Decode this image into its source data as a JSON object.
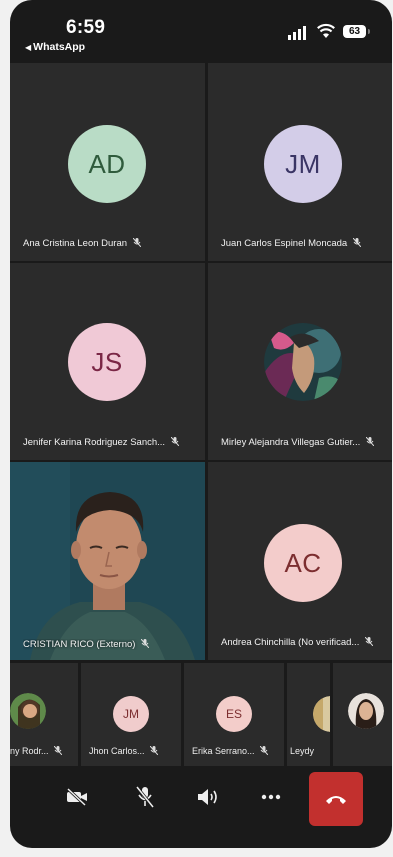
{
  "status_bar": {
    "time": "6:59",
    "back_label": "WhatsApp",
    "battery": "63"
  },
  "tiles": [
    {
      "name": "Ana Cristina Leon Duran",
      "initials": "AD",
      "avatar_bg": "#b9dcc6",
      "avatar_fg": "#2f5b3c"
    },
    {
      "name": "Juan Carlos Espinel Moncada",
      "initials": "JM",
      "avatar_bg": "#d3cde8",
      "avatar_fg": "#3a3565"
    },
    {
      "name": "Jenifer Karina Rodriguez Sanch...",
      "initials": "JS",
      "avatar_bg": "#f0c9d6",
      "avatar_fg": "#7a2746"
    },
    {
      "name": "Mirley Alejandra Villegas Gutier...",
      "initials": "",
      "avatar_bg": "#1f3a3e",
      "avatar_fg": "#ffffff"
    },
    {
      "name": "CRISTIAN RICO (Externo)",
      "initials": "",
      "avatar_bg": "",
      "avatar_fg": ""
    },
    {
      "name": "Andrea Chinchilla  (No verificad...",
      "initials": "AC",
      "avatar_bg": "#f3cccb",
      "avatar_fg": "#7c2e30"
    }
  ],
  "strip": [
    {
      "name": "ny Rodr...",
      "initials": "",
      "avatar_bg": "#d7b38a",
      "avatar_fg": "#333333"
    },
    {
      "name": "Jhon Carlos...",
      "initials": "JM",
      "avatar_bg": "#f0cccc",
      "avatar_fg": "#7c2e30"
    },
    {
      "name": "Erika Serrano...",
      "initials": "ES",
      "avatar_bg": "#f3cdca",
      "avatar_fg": "#7c2e30"
    },
    {
      "name": "Leydy",
      "initials": "",
      "avatar_bg": "#d9c9a0",
      "avatar_fg": "#333333"
    },
    {
      "name": "",
      "initials": "",
      "avatar_bg": "#e8e2dc",
      "avatar_fg": "#333333"
    }
  ],
  "controls": {
    "camera_icon": "camera-off-icon",
    "mic_icon": "mic-off-icon",
    "speaker_icon": "speaker-icon",
    "more_icon": "more-icon",
    "end_call_icon": "end-call-icon",
    "end_call_color": "#c2302e"
  }
}
